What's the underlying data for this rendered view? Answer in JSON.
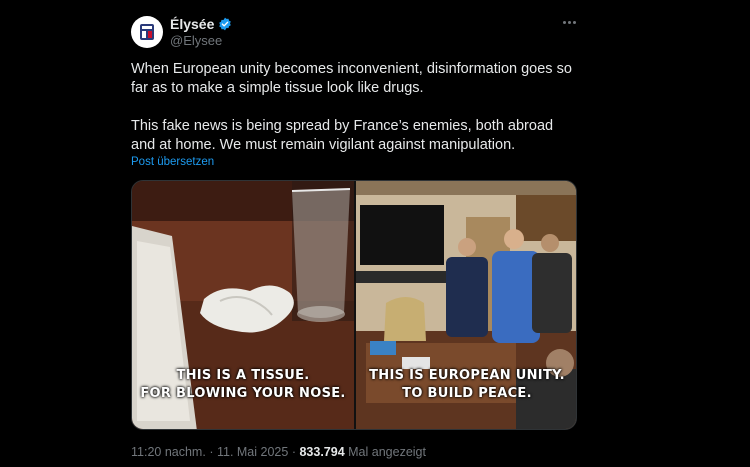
{
  "author": {
    "display_name": "Élysée",
    "handle": "@Elysee",
    "verified": true,
    "avatar_icon": "elysee-seal-icon"
  },
  "tweet": {
    "paragraph1": "When European unity becomes inconvenient, disinformation goes so far as to make a simple tissue look like drugs.",
    "paragraph2": "This fake news is being spread by France’s enemies, both abroad and at home. We must remain vigilant against manipulation.",
    "translate_label": "Post übersetzen"
  },
  "media": {
    "left_caption_line1": "THIS IS A TISSUE.",
    "left_caption_line2": "FOR BLOWING YOUR NOSE.",
    "right_caption_line1": "THIS IS EUROPEAN UNITY.",
    "right_caption_line2": "TO BUILD PEACE."
  },
  "meta": {
    "time": "11:20 nachm.",
    "separator": "·",
    "date": "11. Mai 2025",
    "views_count": "833.794",
    "views_label": "Mal angezeigt"
  },
  "colors": {
    "background": "#000000",
    "text_primary": "#e7e9ea",
    "text_secondary": "#71767b",
    "link": "#1d9bf0",
    "verified": "#1d9bf0"
  }
}
